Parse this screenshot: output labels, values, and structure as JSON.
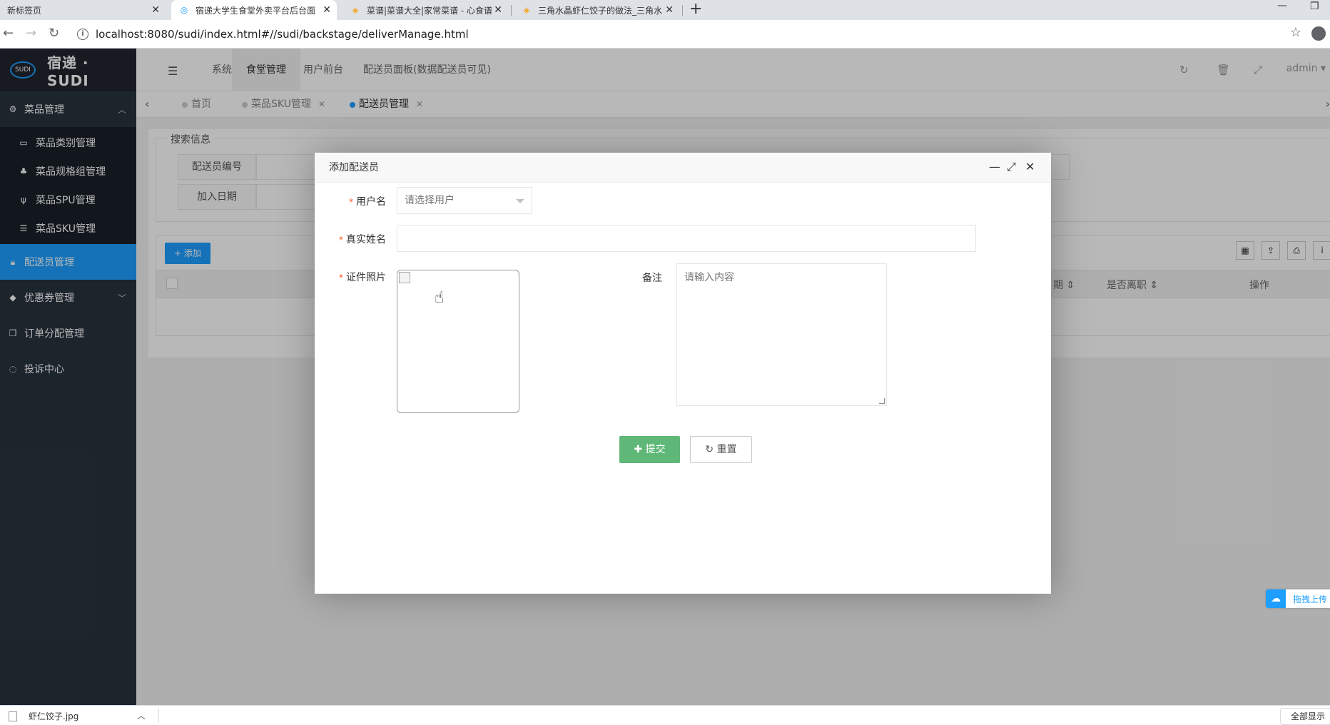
{
  "browser": {
    "tabs": [
      {
        "title": "新标签页"
      },
      {
        "title": "宿递大学生食堂外卖平台后台面板"
      },
      {
        "title": "菜谱|菜谱大全|家常菜谱 - 心食谱"
      },
      {
        "title": "三角水晶虾仁饺子的做法_三角水"
      }
    ],
    "url": "localhost:8080/sudi/index.html#//sudi/backstage/deliverManage.html"
  },
  "sidebar": {
    "logo_badge": "SUDI",
    "logo_text": "宿递 · SUDI",
    "items": [
      {
        "label": "菜品管理",
        "icon": "gear-icon"
      },
      {
        "label": "菜品类别管理",
        "icon": "inbox-icon"
      },
      {
        "label": "菜品规格组管理",
        "icon": "sitemap-icon"
      },
      {
        "label": "菜品SPU管理",
        "icon": "utensils-icon"
      },
      {
        "label": "菜品SKU管理",
        "icon": "list-icon"
      },
      {
        "label": "配送员管理",
        "icon": "lock-icon"
      },
      {
        "label": "优惠券管理",
        "icon": "tag-icon"
      },
      {
        "label": "订单分配管理",
        "icon": "copy-icon"
      },
      {
        "label": "投诉中心",
        "icon": "chat-icon"
      }
    ]
  },
  "topnav": {
    "items": [
      "系统管理",
      "食堂管理",
      "用户前台",
      "配送员面板(数据配送员可见)"
    ],
    "user": "admin"
  },
  "pagetabs": [
    "首页",
    "菜品SKU管理",
    "配送员管理"
  ],
  "search": {
    "legend": "搜索信息",
    "fields": [
      "配送员编号",
      "加入日期"
    ]
  },
  "table": {
    "add_label": "添加",
    "headers": [
      "期",
      "是否离职",
      "操作"
    ]
  },
  "dialog": {
    "title": "添加配送员",
    "username_label": "用户名",
    "username_placeholder": "请选择用户",
    "realname_label": "真实姓名",
    "photo_label": "证件照片",
    "remark_label": "备注",
    "remark_placeholder": "请输入内容",
    "submit_label": "提交",
    "reset_label": "重置"
  },
  "upload_widget": "拖拽上传",
  "download_bar": {
    "file": "虾仁饺子.jpg",
    "show_all": "全部显示"
  }
}
